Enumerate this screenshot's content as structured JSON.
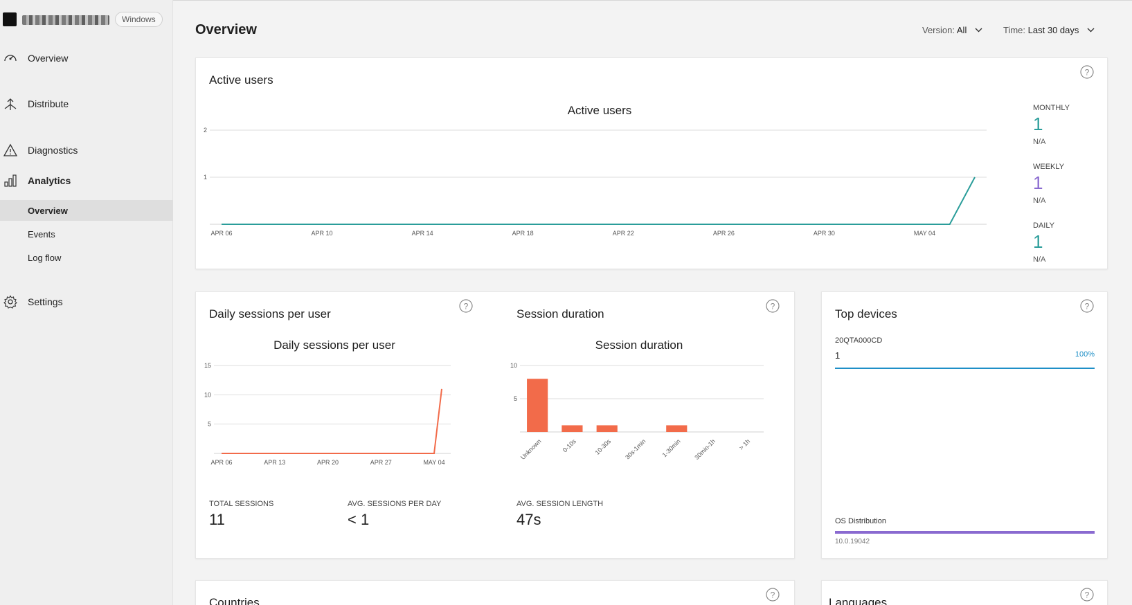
{
  "app": {
    "platform": "Windows"
  },
  "sidebar": {
    "items": [
      {
        "label": "Overview",
        "icon": "gauge-icon"
      },
      {
        "label": "Distribute",
        "icon": "distribute-icon"
      },
      {
        "label": "Diagnostics",
        "icon": "warning-icon"
      },
      {
        "label": "Analytics",
        "icon": "bar-chart-icon"
      },
      {
        "label": "Settings",
        "icon": "gear-icon"
      }
    ],
    "analytics_sub": [
      {
        "label": "Overview",
        "active": true
      },
      {
        "label": "Events",
        "active": false
      },
      {
        "label": "Log flow",
        "active": false
      }
    ]
  },
  "header": {
    "title": "Overview",
    "version_label": "Version:",
    "version_value": "All",
    "time_label": "Time:",
    "time_value": "Last 30 days"
  },
  "active_users": {
    "card_title": "Active users",
    "monthly": {
      "label": "MONTHLY",
      "value": "1",
      "sub": "N/A",
      "color": "#2a9d9a"
    },
    "weekly": {
      "label": "WEEKLY",
      "value": "1",
      "sub": "N/A",
      "color": "#8a6ad0"
    },
    "daily": {
      "label": "DAILY",
      "value": "1",
      "sub": "N/A",
      "color": "#2a9d9a"
    }
  },
  "daily_sessions": {
    "card_title": "Daily sessions per user",
    "total_label": "TOTAL SESSIONS",
    "total_value": "11",
    "avg_label": "AVG. SESSIONS PER DAY",
    "avg_value": "< 1"
  },
  "session_duration": {
    "card_title": "Session duration",
    "avg_label": "AVG. SESSION LENGTH",
    "avg_value": "47s"
  },
  "top_devices": {
    "card_title": "Top devices",
    "device_name": "20QTA000CD",
    "device_count": "1",
    "device_percent": "100%",
    "device_fraction": 1.0,
    "device_color": "#1e8fc7",
    "os_label": "OS Distribution",
    "os_version": "10.0.19042",
    "os_fraction": 1.0,
    "os_color": "#8a6ad0"
  },
  "countries": {
    "card_title": "Countries"
  },
  "languages": {
    "card_title": "Languages"
  },
  "chart_data": [
    {
      "type": "line",
      "title": "Active users",
      "x": [
        "APR 06",
        "APR 10",
        "APR 14",
        "APR 18",
        "APR 22",
        "APR 26",
        "APR 30",
        "MAY 04"
      ],
      "yticks": [
        1,
        2
      ],
      "ylim": [
        0,
        2
      ],
      "series": [
        {
          "points": [
            [
              0,
              0
            ],
            [
              29,
              0
            ],
            [
              30,
              1
            ]
          ],
          "color": "#2a9d9a"
        }
      ],
      "x_index_range": [
        0,
        30
      ],
      "tick_indices": [
        0,
        4,
        8,
        12,
        16,
        20,
        24,
        28
      ],
      "grid": true
    },
    {
      "type": "line",
      "title": "Daily sessions per user",
      "x": [
        "APR 06",
        "APR 13",
        "APR 20",
        "APR 27",
        "MAY 04"
      ],
      "yticks": [
        5,
        10,
        15
      ],
      "ylim": [
        0,
        15
      ],
      "series": [
        {
          "points": [
            [
              0,
              0
            ],
            [
              28,
              0
            ],
            [
              29,
              11
            ]
          ],
          "color": "#f26b4a"
        }
      ],
      "x_index_range": [
        0,
        29
      ],
      "tick_indices": [
        0,
        7,
        14,
        21,
        28
      ],
      "grid": true
    },
    {
      "type": "bar",
      "title": "Session duration",
      "categories": [
        "Unknown",
        "0-10s",
        "10-30s",
        "30s-1min",
        "1-30min",
        "30min-1h",
        "> 1h"
      ],
      "values": [
        8,
        1,
        1,
        0,
        1,
        0,
        0
      ],
      "yticks": [
        5,
        10
      ],
      "ylim": [
        0,
        10
      ],
      "color": "#f26b4a",
      "grid": true
    }
  ]
}
